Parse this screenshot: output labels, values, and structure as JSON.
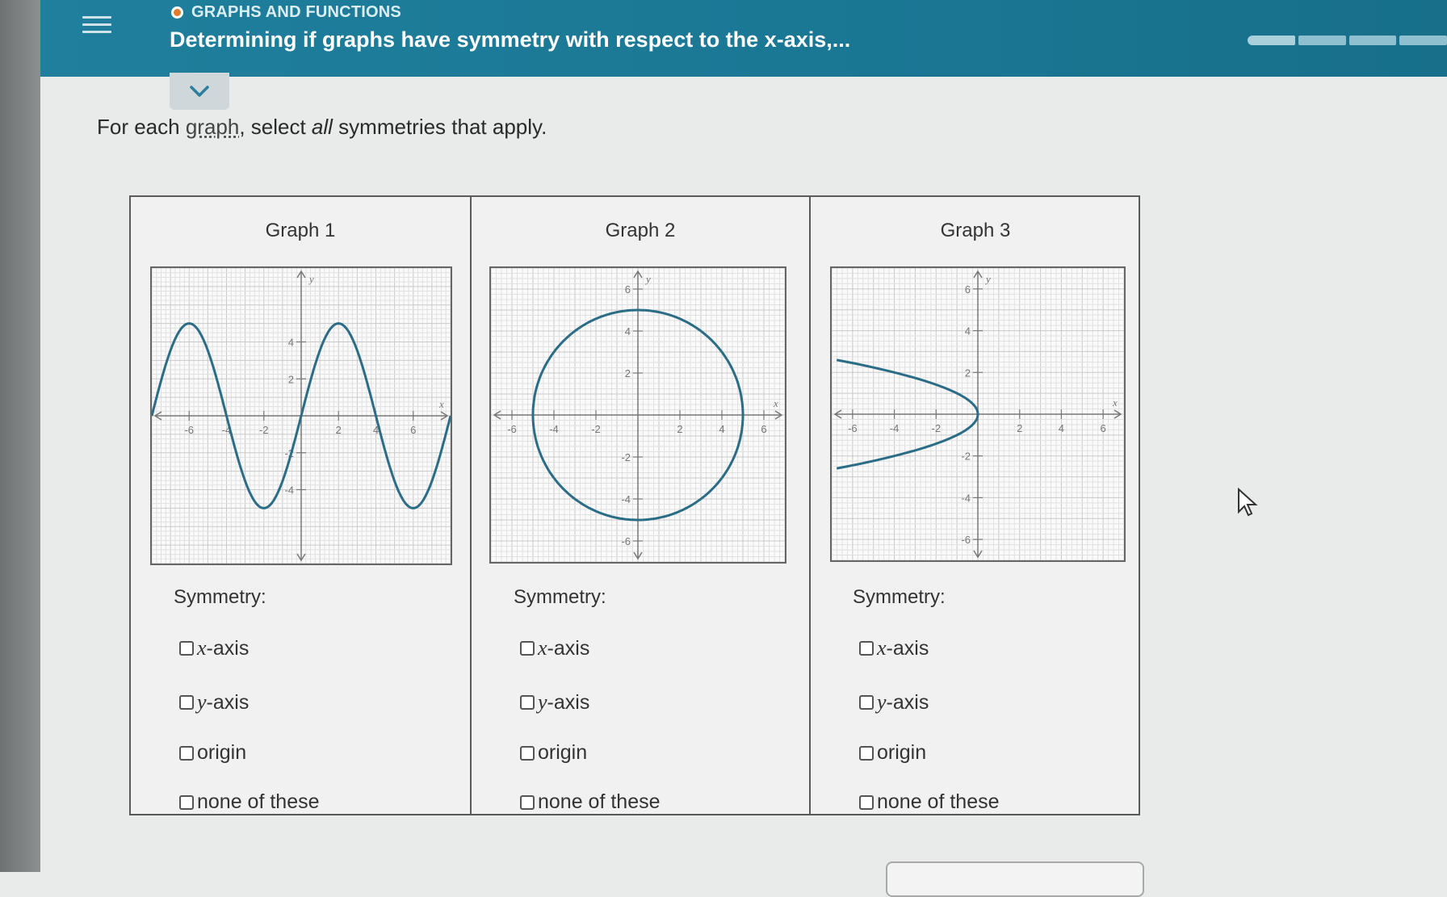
{
  "header": {
    "topic": "GRAPHS AND FUNCTIONS",
    "title": "Determining if graphs have symmetry with respect to the x-axis,..."
  },
  "instruction": {
    "prefix": "For each ",
    "link": "graph",
    "middle": ", select ",
    "emph": "all",
    "suffix": " symmetries that apply."
  },
  "graphs": [
    {
      "title": "Graph 1",
      "symmetry_label": "Symmetry:",
      "options": [
        {
          "var": "x",
          "text": "-axis"
        },
        {
          "var": "y",
          "text": "-axis"
        },
        {
          "var": "",
          "text": "origin"
        },
        {
          "var": "",
          "text": "none of these"
        }
      ]
    },
    {
      "title": "Graph 2",
      "symmetry_label": "Symmetry:",
      "options": [
        {
          "var": "x",
          "text": "-axis"
        },
        {
          "var": "y",
          "text": "-axis"
        },
        {
          "var": "",
          "text": "origin"
        },
        {
          "var": "",
          "text": "none of these"
        }
      ]
    },
    {
      "title": "Graph 3",
      "symmetry_label": "Symmetry:",
      "options": [
        {
          "var": "x",
          "text": "-axis"
        },
        {
          "var": "y",
          "text": "-axis"
        },
        {
          "var": "",
          "text": "origin"
        },
        {
          "var": "",
          "text": "none of these"
        }
      ]
    }
  ],
  "plots": {
    "axis_x_label": "x",
    "axis_y_label": "y",
    "graph1": {
      "x_range": [
        -8,
        8
      ],
      "y_range": [
        -8,
        8
      ],
      "x_ticks": [
        -6,
        -4,
        -2,
        2,
        4,
        6
      ],
      "y_ticks": [
        -4,
        -2,
        2,
        4
      ],
      "x_tick_labels": [
        "-6",
        "-4",
        "-2",
        "2",
        "4",
        "6"
      ],
      "y_tick_labels": [
        "4",
        "2",
        "-2",
        "-4"
      ],
      "curve": "sine",
      "amplitude": 5,
      "period": 8
    },
    "graph2": {
      "x_range": [
        -7,
        7
      ],
      "y_range": [
        -7,
        7
      ],
      "x_ticks": [
        -6,
        -4,
        -2,
        2,
        4,
        6
      ],
      "y_ticks": [
        -6,
        -4,
        -2,
        2,
        4,
        6
      ],
      "x_tick_labels": [
        "-6",
        "-4",
        "-2",
        "2",
        "4",
        "6"
      ],
      "y_tick_labels": [
        "6",
        "4",
        "2",
        "-2",
        "-4",
        "-6"
      ],
      "curve": "circle",
      "radius": 5
    },
    "graph3": {
      "x_range": [
        -7,
        7
      ],
      "y_range": [
        -7,
        7
      ],
      "x_ticks": [
        -6,
        -4,
        -2,
        2,
        4,
        6
      ],
      "y_ticks": [
        -6,
        -4,
        -2,
        2,
        4,
        6
      ],
      "x_tick_labels": [
        "-6",
        "-4",
        "-2",
        "2",
        "4",
        "6"
      ],
      "y_tick_labels": [
        "6",
        "4",
        "2",
        "-2",
        "-4",
        "-6"
      ],
      "curve": "parabola-left",
      "vertex": [
        0,
        0
      ]
    }
  },
  "colors": {
    "curve": "#2b6c86",
    "header": "#1f7f9c"
  }
}
